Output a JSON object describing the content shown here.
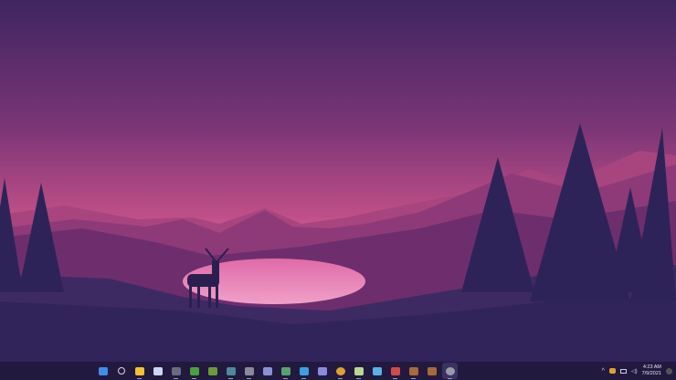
{
  "taskbar": {
    "apps": [
      {
        "name": "start",
        "icon": "windows-icon",
        "color": "#3d8ee8"
      },
      {
        "name": "search",
        "icon": "search-icon",
        "color": "#d8d8e8"
      },
      {
        "name": "file-explorer",
        "icon": "folder-icon",
        "color": "#f2c230"
      },
      {
        "name": "steam",
        "icon": "steam-icon",
        "color": "#c8d8f0"
      },
      {
        "name": "terminal",
        "icon": "terminal-icon",
        "color": "#6a6a80"
      },
      {
        "name": "xbox",
        "icon": "xbox-icon",
        "color": "#49a03c"
      },
      {
        "name": "minecraft",
        "icon": "minecraft-icon",
        "color": "#6b9a3a"
      },
      {
        "name": "app-network",
        "icon": "network-app-icon",
        "color": "#4a8a9a"
      },
      {
        "name": "app-gray",
        "icon": "window-app-icon",
        "color": "#8a8a9a"
      },
      {
        "name": "app-photos",
        "icon": "photos-icon",
        "color": "#8a90d8"
      },
      {
        "name": "app-green",
        "icon": "green-app-icon",
        "color": "#5aa070"
      },
      {
        "name": "app-cloud",
        "icon": "cloud-icon",
        "color": "#3aa0e0"
      },
      {
        "name": "app-purple",
        "icon": "purple-app-icon",
        "color": "#8a8ae0"
      },
      {
        "name": "chrome",
        "icon": "chrome-icon",
        "color": "#e0a030"
      },
      {
        "name": "app-notepad",
        "icon": "notepad-icon",
        "color": "#b8d890"
      },
      {
        "name": "mail",
        "icon": "mail-icon",
        "color": "#5ab0e8"
      },
      {
        "name": "app-red",
        "icon": "red-app-icon",
        "color": "#d04a4a"
      },
      {
        "name": "app-box1",
        "icon": "box-icon",
        "color": "#a86a3a"
      },
      {
        "name": "app-box2",
        "icon": "box-icon",
        "color": "#a86a3a"
      },
      {
        "name": "settings",
        "icon": "gear-icon",
        "color": "#9a9aa8"
      }
    ]
  },
  "tray": {
    "time": "4:23 AM",
    "date": "7/9/2021"
  }
}
